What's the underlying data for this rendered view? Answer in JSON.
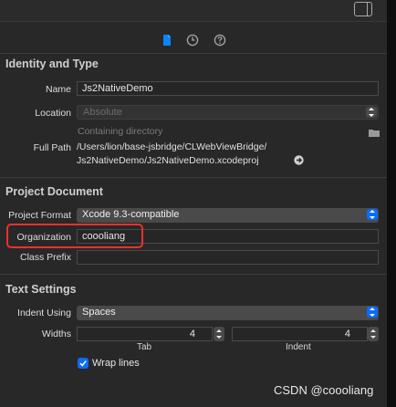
{
  "tabs": {
    "file": "file-inspector-icon",
    "history": "history-icon",
    "help": "help-icon"
  },
  "identity": {
    "title": "Identity and Type",
    "name_label": "Name",
    "name_value": "Js2NativeDemo",
    "location_label": "Location",
    "location_value": "Absolute",
    "location_hint": "Containing directory",
    "fullpath_label": "Full Path",
    "fullpath_line1": "/Users/lion/base-jsbridge/CLWebViewBridge/",
    "fullpath_line2": "Js2NativeDemo/Js2NativeDemo.xcodeproj"
  },
  "project": {
    "title": "Project Document",
    "format_label": "Project Format",
    "format_value": "Xcode 9.3-compatible",
    "org_label": "Organization",
    "org_value": "coooliang",
    "prefix_label": "Class Prefix",
    "prefix_value": ""
  },
  "text": {
    "title": "Text Settings",
    "indent_label": "Indent Using",
    "indent_value": "Spaces",
    "widths_label": "Widths",
    "tab_value": "4",
    "indent_width_value": "4",
    "tab_caption": "Tab",
    "indent_caption": "Indent",
    "wrap_label": "Wrap lines",
    "wrap_checked": true
  },
  "watermark": "CSDN @coooliang",
  "colors": {
    "accent": "#0a6cff",
    "highlight": "#e8322b"
  }
}
